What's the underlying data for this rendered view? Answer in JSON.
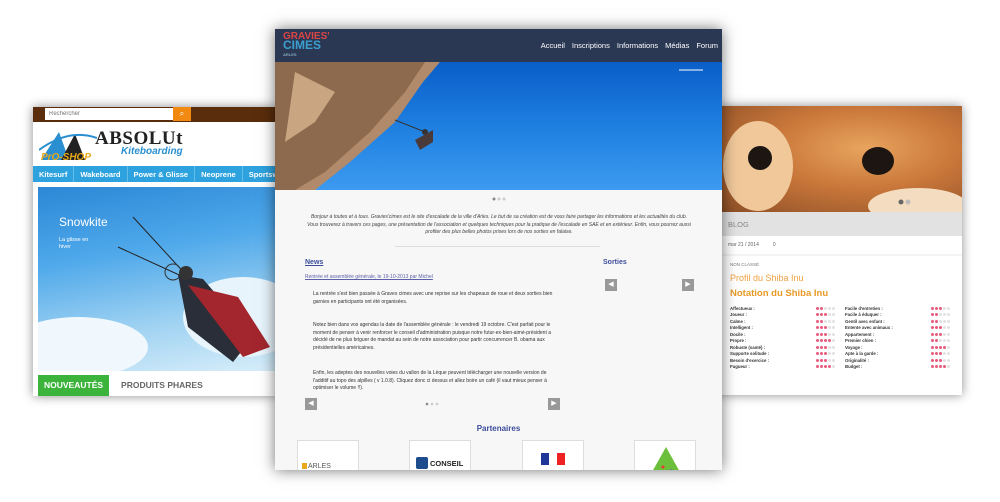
{
  "left": {
    "search_placeholder": "Rechercher",
    "search_icon": "search-icon",
    "logo": {
      "word1": "ABSOLUt",
      "word2": "Kiteboarding",
      "word3": "PrO-SHOP"
    },
    "nav": [
      "Kitesurf",
      "Wakeboard",
      "Power & Glisse",
      "Neoprene",
      "Sportswear"
    ],
    "hero": {
      "title": "Snowkite",
      "subtitle": "La glisse en hiver"
    },
    "tabs": [
      "NOUVEAUTÉS",
      "PRODUITS PHARES"
    ],
    "colors": {
      "topbar": "#5a2d0c",
      "nav": "#2ea2de",
      "accent": "#f28a12",
      "tab": "#3cb43c"
    }
  },
  "center": {
    "brand": {
      "line1": "GRAVIES'",
      "line2": "CIMES",
      "line3": "ARLES"
    },
    "menu": [
      "Accueil",
      "Inscriptions",
      "Informations",
      "Médias",
      "Forum"
    ],
    "intro": "Bonjour à toutes et à tous. Gravies'cimes est le site d'escalade de la ville d'Arles. Le but de sa création est de vous faire partager les informations et les actualités du club. Vous trouverez à travers ces pages, une présentation de l'association et quelques techniques pour la pratique de l'escalade en SAE et en extérieur. Enfin, vous pourrez aussi profiter des plus belles photos prises lors de nos sorties en falaise.",
    "news_heading": "News",
    "sorties_heading": "Sorties",
    "news_link": "Rentrée et assemblée générale, le 19-10-2013 par Michel",
    "paragraphs": [
      {
        "text": "La rentrée s'est bien passée à Graves cimes avec une reprise sur les chapeaux de roue et deux sorties bien garnies en participants ont été organisées."
      },
      {
        "text": "Notez bien dans vos agendas la date de l'assemblée générale : le vendredi 19 octobre. C'est parfait pour le moment de penser à venir renforcer le conseil d'administration puisque notre futur-ex-bien-aimé-président a décidé de ne plus briguer de mandat au sein de notre association pour partir concurrencer B. obama aux présidentielles américaines."
      },
      {
        "text": "Enfin, les adeptes des nouvelles voies du vallon de la Lèque peuvent télécharger une nouvelle version de l'additif au topo des alpilles ( v 1.0.8). Cliquez donc ci dessus et allez boire un café (il vaut mieux penser à optimiser le volume !!)."
      }
    ],
    "partners_heading": "Partenaires",
    "partner_labels": [
      "ARLES",
      "CONSEIL",
      "",
      ""
    ],
    "colors": {
      "header": "#2b3854",
      "link": "#3c4c9a"
    }
  },
  "right": {
    "blog_label": "BLOG",
    "date": "mar 21 / 2014",
    "comments": "0",
    "category": "NON CLASSÉ",
    "title": "Profil du Shiba Inu",
    "subtitle": "Notation du Shiba Inu",
    "ratings_left": [
      {
        "label": "Affectueux :",
        "score": 2
      },
      {
        "label": "Joueur :",
        "score": 3
      },
      {
        "label": "Calme :",
        "score": 2
      },
      {
        "label": "Intelligent :",
        "score": 3
      },
      {
        "label": "Docile :",
        "score": 3
      },
      {
        "label": "Propre :",
        "score": 4
      },
      {
        "label": "Robuste (santé) :",
        "score": 3
      },
      {
        "label": "Supporte solitude :",
        "score": 3
      },
      {
        "label": "Besoin d'exercice :",
        "score": 3
      },
      {
        "label": "Fugueur :",
        "score": 4
      }
    ],
    "ratings_right": [
      {
        "label": "Facile d'entretien :",
        "score": 3
      },
      {
        "label": "Facile à éduquer :",
        "score": 2
      },
      {
        "label": "Gentil avec enfant :",
        "score": 2
      },
      {
        "label": "Entente avec animaux :",
        "score": 3
      },
      {
        "label": "Appartement :",
        "score": 3
      },
      {
        "label": "Premier chien :",
        "score": 2
      },
      {
        "label": "Voyage :",
        "score": 4
      },
      {
        "label": "Apte à la garde :",
        "score": 3
      },
      {
        "label": "Originalité :",
        "score": 3
      },
      {
        "label": "Budget :",
        "score": 4
      }
    ],
    "colors": {
      "rating_on": "#e85b7c",
      "title": "#f0a040"
    }
  }
}
